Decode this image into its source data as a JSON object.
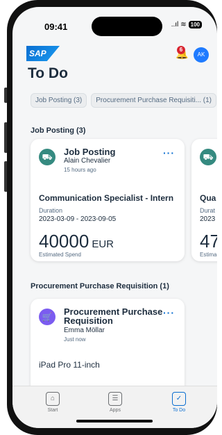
{
  "status_bar": {
    "time": "09:41",
    "battery": "100",
    "signal": "..ıl",
    "wifi": "≋"
  },
  "header": {
    "logo_text": "SAP",
    "notification_count": "6",
    "avatar_initials": "AK"
  },
  "page": {
    "title": "To Do"
  },
  "filters": [
    "Job Posting (3)",
    "Procurement Purchase Requisiti... (1)"
  ],
  "sections": {
    "job_posting": {
      "title": "Job Posting (3)",
      "cards": [
        {
          "title": "Job Posting",
          "person": "Alain Chevalier",
          "time": "15 hours ago",
          "job": "Communication Specialist - Intern",
          "duration_label": "Duration",
          "duration": "2023-03-09 - 2023-09-05",
          "amount": "40000",
          "currency": "EUR",
          "amount_label": "Estimated Spend"
        },
        {
          "job_partial": "Qua",
          "duration_label_partial": "Durat",
          "duration_partial": "2023",
          "amount_partial": "47",
          "amount_label_partial": "Estima"
        }
      ]
    },
    "procurement": {
      "title": "Procurement Purchase Requisition (1)",
      "cards": [
        {
          "title": "Procurement Purchase Requisition",
          "person": "Emma Möllar",
          "time": "Just now",
          "item": "iPad Pro 11-inch"
        }
      ]
    }
  },
  "more_label": "···",
  "tabbar": [
    {
      "label": "Start",
      "icon": "home-icon"
    },
    {
      "label": "Apps",
      "icon": "apps-icon"
    },
    {
      "label": "To Do",
      "icon": "todo-icon"
    }
  ],
  "colors": {
    "accent": "#0a6ed1",
    "job_icon": "#358a80",
    "procurement_icon": "#7b5cf0",
    "badge": "#d9242f"
  }
}
